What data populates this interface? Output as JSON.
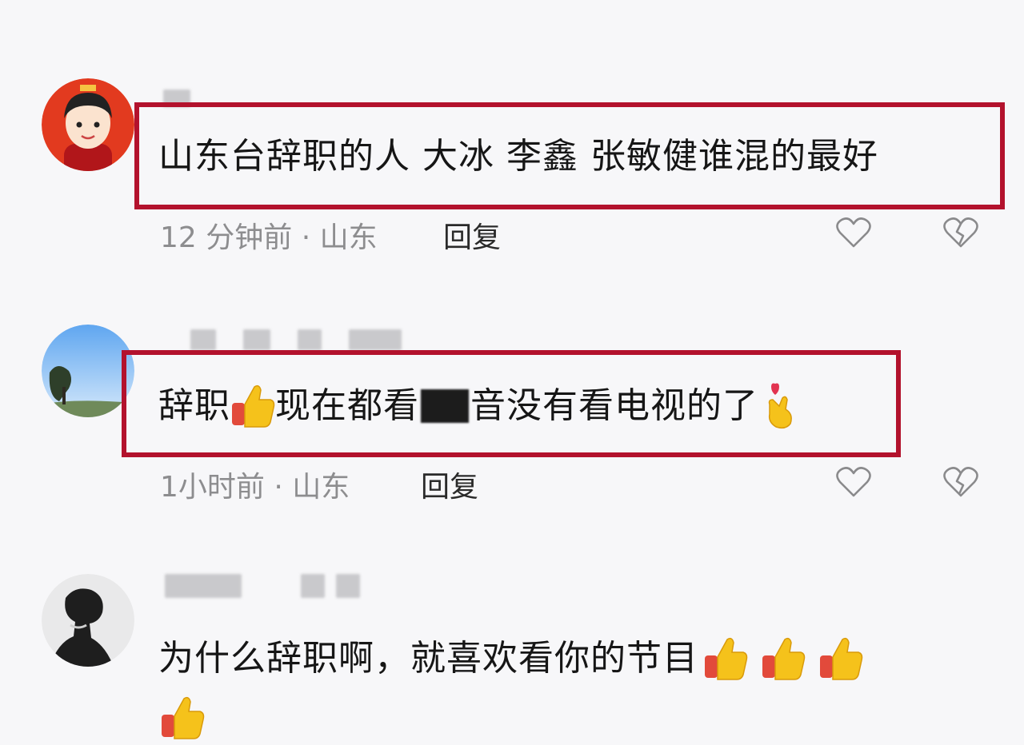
{
  "comments": [
    {
      "segments": [
        "山东台辞职的人 大冰 李鑫 张敏健谁混的最好"
      ],
      "time": "12 分钟前 · 山东",
      "reply": "回复",
      "like_icon": "heart-outline-icon",
      "dislike_icon": "broken-heart-icon"
    },
    {
      "segments": [
        "辞职",
        "现在都看",
        "音没有看电视的了"
      ],
      "emojis": [
        "thumbs-up-emoji",
        "finger-heart-emoji"
      ],
      "time": "1小时前 · 山东",
      "reply": "回复",
      "like_icon": "heart-outline-icon",
      "dislike_icon": "broken-heart-icon"
    },
    {
      "segments": [
        "为什么辞职啊，就喜欢看你的节目"
      ],
      "emojis": [
        "thumbs-up-emoji"
      ]
    }
  ],
  "colors": {
    "highlight_border": "#b3122d",
    "background": "#f7f7f9",
    "meta_text": "#8d8d8f"
  }
}
